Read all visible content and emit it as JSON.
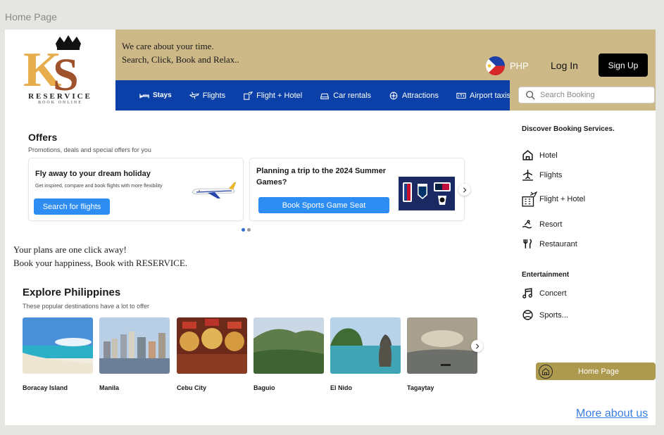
{
  "frame_label": "Home Page",
  "header": {
    "brand": "RESERVICE",
    "brand_sub": "BOOK ONLINE",
    "tagline_1": "We care about your time.",
    "tagline_2": "Search, Click, Book and Relax..",
    "currency": "PHP",
    "login": "Log In",
    "signup": "Sign Up"
  },
  "nav": {
    "stays": "Stays",
    "flights": "Flights",
    "flight_hotel": "Flight + Hotel",
    "car_rentals": "Car rentals",
    "attractions": "Attractions",
    "airport_taxis": "Airport taxis"
  },
  "search": {
    "placeholder": "Search Booking"
  },
  "offers": {
    "title": "Offers",
    "subtitle": "Promotions, deals and special offers for you",
    "card1": {
      "title": "Fly away to your dream holiday",
      "desc": "Get inspired, compare and book flights with more flexibility",
      "button": "Search for flights"
    },
    "card2": {
      "title": "Planning a trip to the 2024 Summer Games?",
      "button": "Book Sports Game Seat"
    }
  },
  "plans": {
    "line1": "Your plans are one click away!",
    "line2": "Book your happiness, Book with RESERVICE."
  },
  "explore": {
    "title": "Explore Philippines",
    "subtitle": "These popular destinations have a lot to offer",
    "destinations": [
      "Boracay Island",
      "Manila",
      "Cebu City",
      "Baguio",
      "El Nido",
      "Tagaytay"
    ]
  },
  "sidebar": {
    "heading": "Discover Booking Services.",
    "services": [
      "Hotel",
      "Flights",
      "Flight + Hotel",
      "Resort",
      "Restaurant"
    ],
    "ent_heading": "Entertainment",
    "entertainment": [
      "Concert",
      "Sports..."
    ],
    "home_pill": "Home Page"
  },
  "footer": {
    "more": "More about us"
  }
}
